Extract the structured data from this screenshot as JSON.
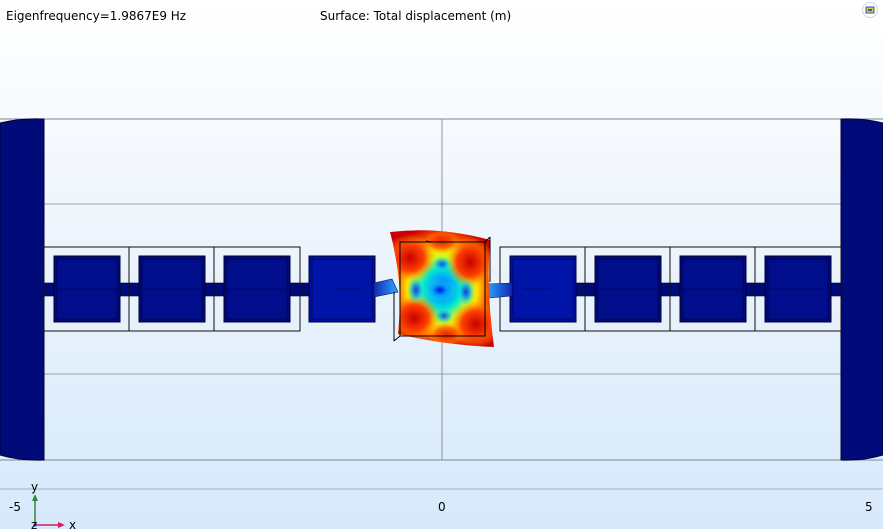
{
  "header": {
    "eigenfrequency": "Eigenfrequency=1.9867E9 Hz",
    "surface_label": "Surface: Total displacement (m)"
  },
  "x_ticks": [
    "-5",
    "0",
    "5"
  ],
  "triad": {
    "y": "y",
    "x": "x",
    "z": "z"
  },
  "colors": {
    "structure": "#000a78",
    "structure_dark": "#000044",
    "structure_light": "#1a2aa8",
    "background_top": "#ffffff",
    "background_bottom": "#d6e9fb",
    "axis_x": "#d81b60",
    "axis_y": "#2e8b2e"
  },
  "icons": {
    "corner": "view-settings-icon"
  }
}
